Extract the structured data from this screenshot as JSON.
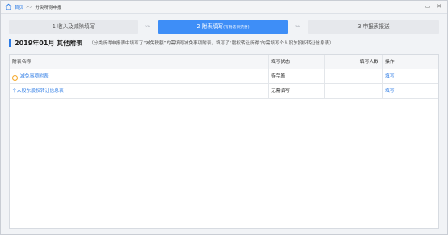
{
  "titlebar": {
    "home": "首页",
    "separator": ">>",
    "current": "分类所得申报",
    "minimize": "▭",
    "close": "✕"
  },
  "steps": [
    {
      "label": "1 收入及减除填写",
      "sub": ""
    },
    {
      "label": "2 附表填写",
      "sub": "(有附表待完善)"
    },
    {
      "label": "3 申报表报送",
      "sub": ""
    }
  ],
  "step_arrow": "»»",
  "section": {
    "title": "2019年01月   其他附表",
    "note": "（分类所得申报表中填写了“减免税额”的需填写减免事项附表，填写了“股权转让所得”的需填写个人股东股权转让信息表）"
  },
  "table": {
    "headers": [
      "附表名称",
      "填写状态",
      "填写人数",
      "操作"
    ],
    "rows": [
      {
        "name": "减免事项附表",
        "status": "待完善",
        "count": "",
        "op": "填写",
        "warn": true
      },
      {
        "name": "个人股东股权转让信息表",
        "status": "无需填写",
        "count": "",
        "op": "填写",
        "warn": false
      }
    ]
  },
  "colors": {
    "accent": "#3e8ef7",
    "link": "#2c7be5",
    "warning": "#f5a623"
  }
}
